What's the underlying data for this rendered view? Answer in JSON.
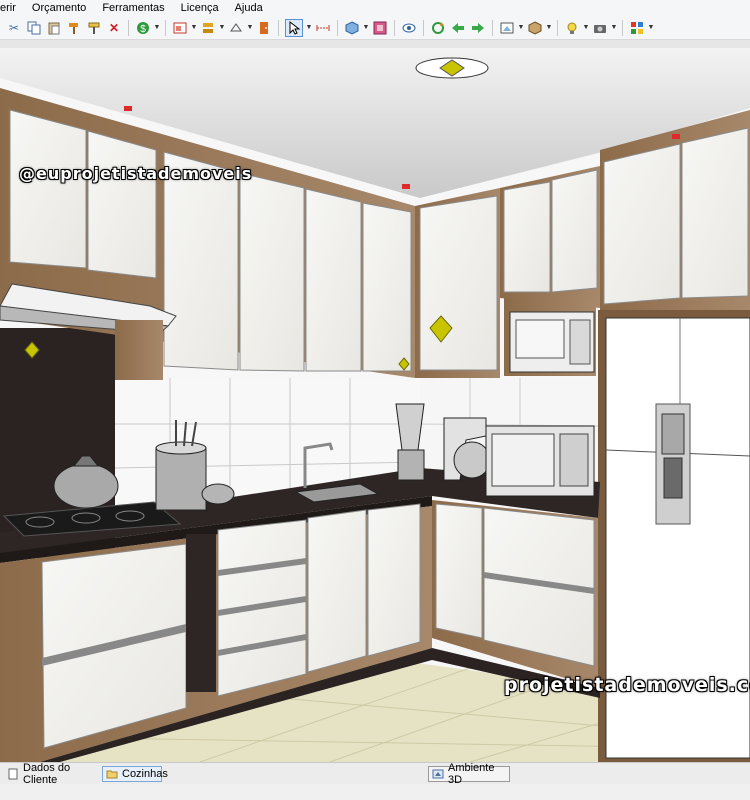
{
  "menu": {
    "items": [
      "erir",
      "Orçamento",
      "Ferramentas",
      "Licença",
      "Ajuda"
    ]
  },
  "toolbar": {
    "icons": [
      "scissors-icon",
      "copy-icon",
      "paste-icon",
      "hammer-icon",
      "paint-icon",
      "delete-icon",
      "money-icon",
      "layout-icon",
      "stack-icon",
      "shape-icon",
      "door-icon",
      "cursor-icon",
      "measure-icon",
      "cube-icon",
      "palette-icon",
      "eye-icon",
      "rotate-icon",
      "arrow-left-icon",
      "arrow-right-icon",
      "view-icon",
      "box-icon",
      "lamp-icon",
      "camera-icon",
      "grid-icon"
    ]
  },
  "watermarks": {
    "top": "@euprojetistademoveis",
    "bottom": "projetistademoveis.com"
  },
  "statusbar": {
    "tabs": [
      {
        "label": "Dados do Cliente"
      },
      {
        "label": "Cozinhas"
      },
      {
        "label": "Ambiente 3D"
      }
    ]
  },
  "colors": {
    "wood": "#9b7b5a",
    "white_panel": "#f3f2ee",
    "countertop": "#2e2625",
    "floor": "#e6e2c4",
    "accent_yellow": "#c8c400"
  }
}
